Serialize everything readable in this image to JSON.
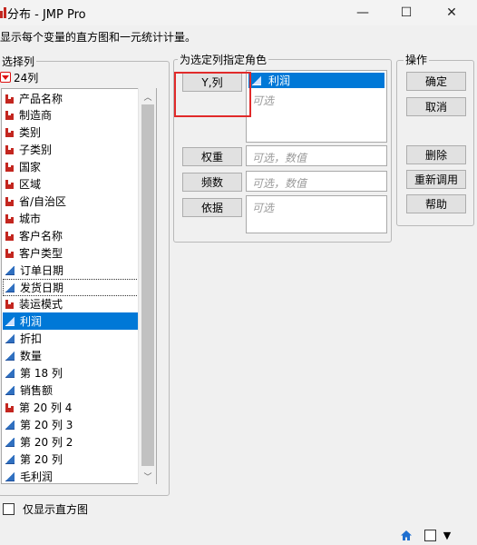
{
  "window": {
    "title": "分布 - JMP Pro"
  },
  "controls": {
    "minimize": "—",
    "maximize": "☐",
    "close": "✕"
  },
  "subtitle": "显示每个变量的直方图和一元统计计量。",
  "select_columns": {
    "legend": "选择列",
    "count": "24列",
    "items": [
      {
        "label": "产品名称",
        "icon": "nominal-icon"
      },
      {
        "label": "制造商",
        "icon": "nominal-icon"
      },
      {
        "label": "类别",
        "icon": "nominal-icon"
      },
      {
        "label": "子类别",
        "icon": "nominal-icon"
      },
      {
        "label": "国家",
        "icon": "nominal-icon"
      },
      {
        "label": "区域",
        "icon": "nominal-icon"
      },
      {
        "label": "省/自治区",
        "icon": "nominal-icon"
      },
      {
        "label": "城市",
        "icon": "nominal-icon"
      },
      {
        "label": "客户名称",
        "icon": "nominal-icon"
      },
      {
        "label": "客户类型",
        "icon": "nominal-icon"
      },
      {
        "label": "订单日期",
        "icon": "continuous-icon"
      },
      {
        "label": "发货日期",
        "icon": "continuous-icon"
      },
      {
        "label": "装运模式",
        "icon": "nominal-icon"
      },
      {
        "label": "利润",
        "icon": "continuous-icon"
      },
      {
        "label": "折扣",
        "icon": "continuous-icon"
      },
      {
        "label": "数量",
        "icon": "continuous-icon"
      },
      {
        "label": "第 18 列",
        "icon": "continuous-icon"
      },
      {
        "label": "销售额",
        "icon": "continuous-icon"
      },
      {
        "label": "第 20 列 4",
        "icon": "nominal-icon"
      },
      {
        "label": "第 20 列 3",
        "icon": "continuous-icon"
      },
      {
        "label": "第 20 列 2",
        "icon": "continuous-icon"
      },
      {
        "label": "第 20 列",
        "icon": "continuous-icon"
      },
      {
        "label": "毛利润",
        "icon": "continuous-icon"
      }
    ]
  },
  "roles": {
    "legend": "为选定列指定角色",
    "y_button": "Y,列",
    "y_assigned": "利润",
    "y_placeholder": "可选",
    "weight_button": "权重",
    "weight_placeholder": "可选，数值",
    "freq_button": "频数",
    "freq_placeholder": "可选，数值",
    "by_button": "依据",
    "by_placeholder": "可选"
  },
  "actions": {
    "legend": "操作",
    "ok": "确定",
    "cancel": "取消",
    "remove": "删除",
    "recall": "重新调用",
    "help": "帮助"
  },
  "histogram_only": {
    "label": "仅显示直方图",
    "checked": false
  },
  "statusbar": {
    "home_icon": "home-icon",
    "dropdown_arrow": "▼"
  }
}
